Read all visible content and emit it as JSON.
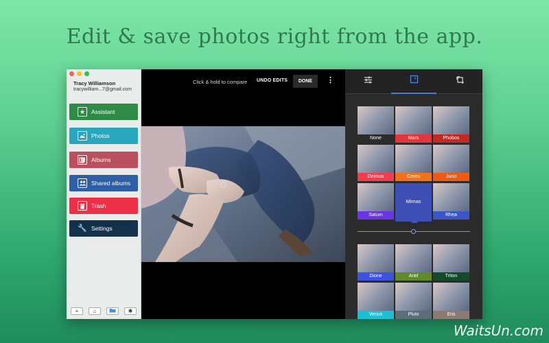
{
  "headline": "Edit & save photos right from the app.",
  "watermark": "WaitsUn.com",
  "user": {
    "name": "Tracy Williamson",
    "email": "tracywilliam...7@gmail.com"
  },
  "sidebar": {
    "items": [
      {
        "label": "Assistant",
        "icon": "star-icon",
        "color": "#2e8b45"
      },
      {
        "label": "Photos",
        "icon": "image-icon",
        "color": "#2aa7bf"
      },
      {
        "label": "Albums",
        "icon": "album-icon",
        "color": "#b9505e"
      },
      {
        "label": "Shared albums",
        "icon": "people-icon",
        "color": "#2f5ea5"
      },
      {
        "label": "Trash",
        "icon": "trash-icon",
        "color": "#ee2f48"
      },
      {
        "label": "Settings",
        "icon": "wrench-icon",
        "color": "#14314b"
      }
    ],
    "bottom": [
      "plus-icon",
      "home-icon",
      "folder-icon",
      "gear-icon"
    ]
  },
  "editor": {
    "compare_hint": "Click & hold to compare",
    "undo_label": "UNDO EDITS",
    "done_label": "DONE"
  },
  "panel": {
    "tabs": [
      "sliders-icon",
      "filter-icon",
      "crop-rotate-icon"
    ],
    "active_tab": 1,
    "filters": [
      {
        "name": "None",
        "color": "#2c2c2c"
      },
      {
        "name": "Mars",
        "color": "#e0373c"
      },
      {
        "name": "Phobos",
        "color": "#c02a23"
      },
      {
        "name": "Deimos",
        "color": "#f33d4f"
      },
      {
        "name": "Ceres",
        "color": "#f2721c"
      },
      {
        "name": "Juno",
        "color": "#ef5b13"
      },
      {
        "name": "Saturn",
        "color": "#6a33e6"
      },
      {
        "name": "Mimas",
        "color": "#3d4fb5",
        "selected": true
      },
      {
        "name": "Rhea",
        "color": "#3b57c7"
      },
      {
        "name": "Dione",
        "color": "#3d53e0"
      },
      {
        "name": "Ariel",
        "color": "#5e8a2c"
      },
      {
        "name": "Triton",
        "color": "#124a2a"
      },
      {
        "name": "Venus",
        "color": "#1dbfd7"
      },
      {
        "name": "Pluto",
        "color": "#5d6d78"
      },
      {
        "name": "Eris",
        "color": "#8c7a73"
      }
    ]
  }
}
